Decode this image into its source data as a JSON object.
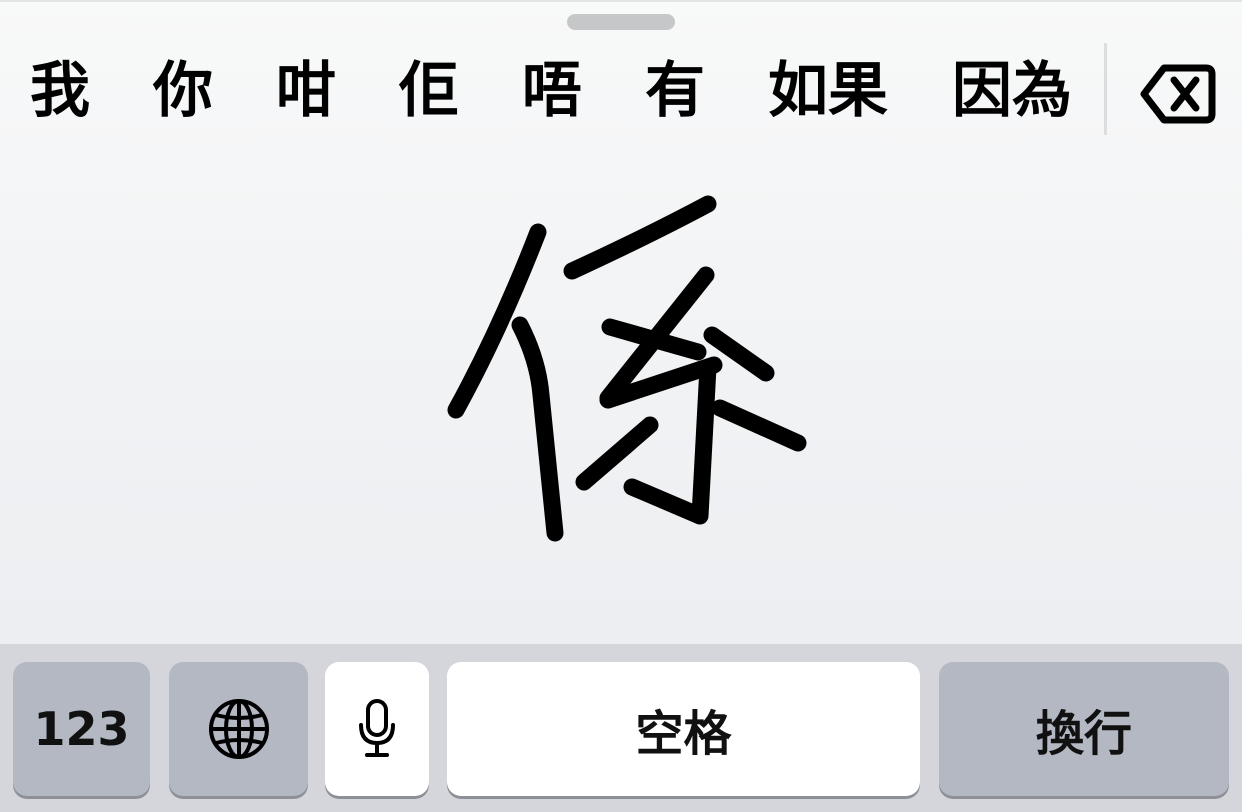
{
  "candidates": [
    "我",
    "你",
    "咁",
    "佢",
    "唔",
    "有",
    "如果",
    "因為"
  ],
  "handwritten_character": "係",
  "bottom_row": {
    "numbers_label": "123",
    "space_label": "空格",
    "return_label": "換行"
  },
  "icons": {
    "delete": "delete-backward-icon",
    "globe": "globe-icon",
    "mic": "microphone-icon"
  }
}
